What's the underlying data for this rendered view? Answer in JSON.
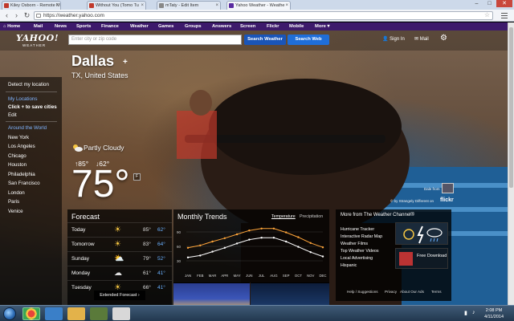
{
  "browser": {
    "tabs": [
      {
        "title": "Kiley Osborn - Remote Mi",
        "active": false,
        "color": "#c0392b"
      },
      {
        "title": "Without You (Tomo Tu",
        "active": false,
        "color": "#c0392b"
      },
      {
        "title": "mTaty - Edit Item",
        "active": false,
        "color": "#888888"
      },
      {
        "title": "Yahoo Weather - Weathe",
        "active": true,
        "color": "#5a2ca0"
      }
    ],
    "url": "https://weather.yahoo.com",
    "window_controls": {
      "minimize": "–",
      "maximize": "□",
      "close": "✕"
    }
  },
  "ynav": [
    "Home",
    "Mail",
    "News",
    "Sports",
    "Finance",
    "Weather",
    "Games",
    "Groups",
    "Answers",
    "Screen",
    "Flickr",
    "Mobile",
    "More ▾"
  ],
  "header": {
    "logo": "YAHOO!",
    "logo_sub": "WEATHER",
    "search_placeholder": "Enter city or zip code",
    "search_weather": "Search Weather",
    "search_web": "Search Web",
    "sign_in": "Sign In",
    "mail": "Mail"
  },
  "location": {
    "city": "Dallas",
    "add": "+",
    "region": "TX, United States"
  },
  "sidebar": {
    "detect": "Detect my location",
    "my_locations": "My Locations",
    "save_hint": "Click + to save cities",
    "edit": "Edit",
    "around": "Around the World",
    "cities": [
      "New York",
      "Los Angeles",
      "Chicago",
      "Houston",
      "Philadelphia",
      "San Francisco",
      "London",
      "Paris",
      "Venice"
    ]
  },
  "current": {
    "condition": "Partly Cloudy",
    "high": "↑85°",
    "low": "↓62°",
    "temp": "75°",
    "unit": "F"
  },
  "photo_credit": {
    "label": "Dale from",
    "credit": "© by Strangely Different on",
    "logo": "flickr"
  },
  "forecast": {
    "title": "Forecast",
    "days": [
      {
        "day": "Today",
        "icon": "☀",
        "high": "85°",
        "low": "62°"
      },
      {
        "day": "Tomorrow",
        "icon": "☀",
        "high": "83°",
        "low": "64°"
      },
      {
        "day": "Sunday",
        "icon": "⛅",
        "high": "79°",
        "low": "52°"
      },
      {
        "day": "Monday",
        "icon": "☁",
        "high": "61°",
        "low": "41°"
      },
      {
        "day": "Tuesday",
        "icon": "☀",
        "high": "66°",
        "low": "41°"
      }
    ],
    "extended": "Extended Forecast ›"
  },
  "trends": {
    "title": "Monthly Trends",
    "tabs": [
      "Temperature",
      "Precipitation"
    ]
  },
  "chart_data": {
    "type": "line",
    "categories": [
      "JAN",
      "FEB",
      "MAR",
      "APR",
      "MAY",
      "JUN",
      "JUL",
      "AUG",
      "SEP",
      "OCT",
      "NOV",
      "DEC"
    ],
    "series": [
      {
        "color": "#ffa53a",
        "values": [
          57,
          62,
          70,
          77,
          85,
          93,
          97,
          97,
          89,
          79,
          67,
          58
        ]
      },
      {
        "color": "#ffffff",
        "values": [
          37,
          41,
          49,
          57,
          66,
          74,
          78,
          78,
          70,
          59,
          48,
          39
        ]
      }
    ],
    "yticks": [
      "90",
      "60",
      "30"
    ],
    "ylim": [
      20,
      105
    ]
  },
  "more": {
    "title": "More from The Weather Channel®",
    "links": [
      "Hurricane Tracker",
      "Interactive Radar Map",
      "Weather Films",
      "Top Weather Videos",
      "Local Advertising",
      "Hispanic"
    ],
    "free_download": "Free Download"
  },
  "footer": [
    "Help / Suggestions",
    "Privacy",
    "About Our Ads",
    "Terms"
  ],
  "taskbar": {
    "time": "2:08 PM",
    "date": "4/11/2014"
  }
}
